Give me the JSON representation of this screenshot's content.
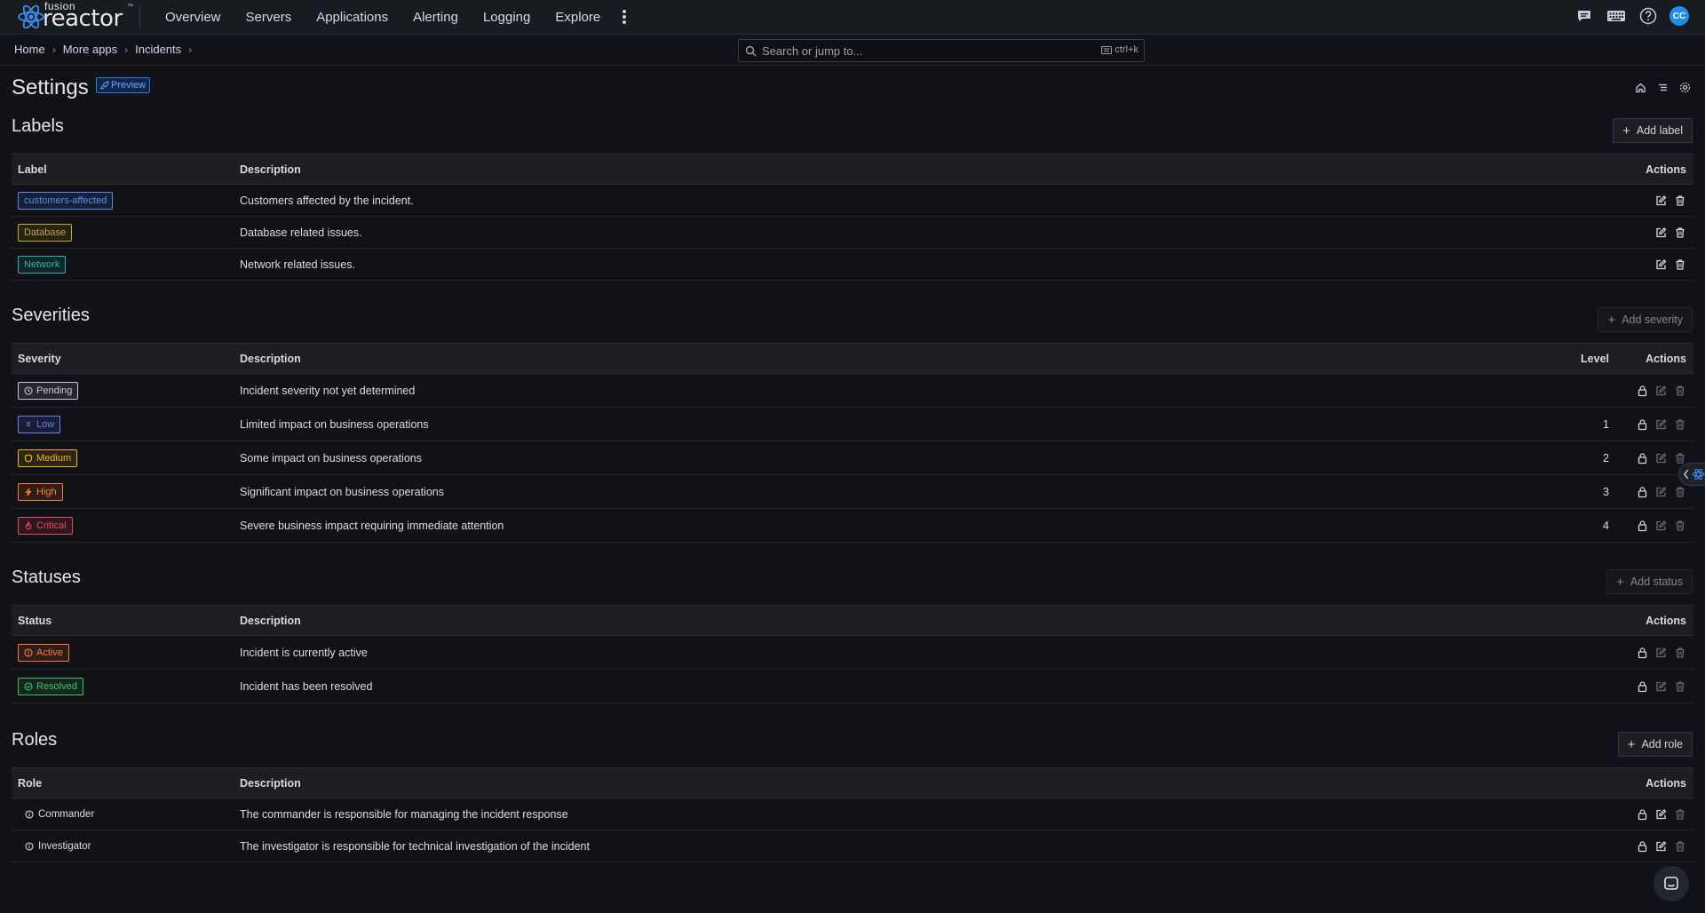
{
  "app": {
    "logo_small": "fusion",
    "logo_big": "reactor",
    "logo_tm": "™"
  },
  "nav": {
    "items": [
      "Overview",
      "Servers",
      "Applications",
      "Alerting",
      "Logging",
      "Explore"
    ],
    "more_icon": "kebab-icon"
  },
  "topbar_icons": [
    "chat-icon",
    "keyboard-icon",
    "help-icon"
  ],
  "user": {
    "initials": "CC",
    "color": "#1f8fe5"
  },
  "breadcrumb": [
    "Home",
    "More apps",
    "Incidents"
  ],
  "search": {
    "placeholder": "Search or jump to...",
    "shortcut": "ctrl+k"
  },
  "page": {
    "title": "Settings",
    "badge": "Preview",
    "tools": [
      "home-icon",
      "list-icon",
      "settings-icon"
    ]
  },
  "labels": {
    "title": "Labels",
    "add": "Add label",
    "columns": {
      "label": "Label",
      "description": "Description",
      "actions": "Actions"
    },
    "rows": [
      {
        "name": "customers-affected",
        "description": "Customers affected by the incident.",
        "color": "#4d8dff"
      },
      {
        "name": "Database",
        "description": "Database related issues.",
        "color": "#c9a227"
      },
      {
        "name": "Network",
        "description": "Network related issues.",
        "color": "#23b4a8"
      }
    ]
  },
  "severities": {
    "title": "Severities",
    "add": "Add severity",
    "columns": {
      "severity": "Severity",
      "description": "Description",
      "level": "Level",
      "actions": "Actions"
    },
    "rows": [
      {
        "name": "Pending",
        "description": "Incident severity not yet determined",
        "level": "",
        "color": "#c8c9d0",
        "icon": "clock-icon"
      },
      {
        "name": "Low",
        "description": "Limited impact on business operations",
        "level": "1",
        "color": "#6b7dff",
        "icon": "chevrons-down-icon"
      },
      {
        "name": "Medium",
        "description": "Some impact on business operations",
        "level": "2",
        "color": "#f2b705",
        "icon": "shield-icon"
      },
      {
        "name": "High",
        "description": "Significant impact on business operations",
        "level": "3",
        "color": "#ff7a30",
        "icon": "bolt-icon"
      },
      {
        "name": "Critical",
        "description": "Severe business impact requiring immediate attention",
        "level": "4",
        "color": "#f2495c",
        "icon": "flame-icon"
      }
    ]
  },
  "statuses": {
    "title": "Statuses",
    "add": "Add status",
    "columns": {
      "status": "Status",
      "description": "Description",
      "actions": "Actions"
    },
    "rows": [
      {
        "name": "Active",
        "description": "Incident is currently active",
        "color": "#ff7a30",
        "icon": "alert-circle-icon"
      },
      {
        "name": "Resolved",
        "description": "Incident has been resolved",
        "color": "#3ec160",
        "icon": "check-circle-icon"
      }
    ]
  },
  "roles": {
    "title": "Roles",
    "add": "Add role",
    "columns": {
      "role": "Role",
      "description": "Description",
      "actions": "Actions"
    },
    "rows": [
      {
        "name": "Commander",
        "description": "The commander is responsible for managing the incident response",
        "icon": "info-circle-icon"
      },
      {
        "name": "Investigator",
        "description": "The investigator is responsible for technical investigation of the incident",
        "icon": "info-circle-icon"
      }
    ]
  }
}
